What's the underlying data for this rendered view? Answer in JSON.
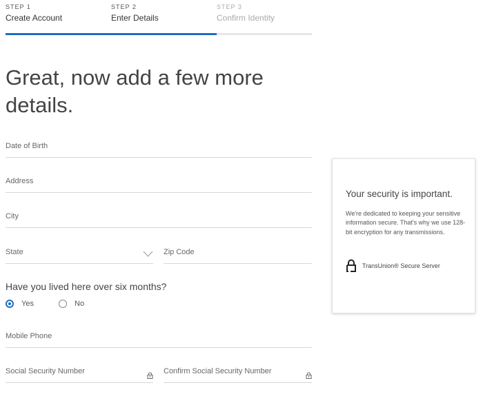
{
  "stepper": {
    "progress_percent": 69,
    "steps": [
      {
        "number": "STEP 1",
        "label": "Create Account",
        "state": "complete"
      },
      {
        "number": "STEP 2",
        "label": "Enter Details",
        "state": "current"
      },
      {
        "number": "STEP 3",
        "label": "Confirm Identity",
        "state": "upcoming"
      }
    ]
  },
  "page_title": "Great, now add a few more details.",
  "form": {
    "date_of_birth": {
      "label": "Date of Birth",
      "value": ""
    },
    "address": {
      "label": "Address",
      "value": ""
    },
    "city": {
      "label": "City",
      "value": ""
    },
    "state": {
      "label": "State",
      "value": ""
    },
    "zip": {
      "label": "Zip Code",
      "value": ""
    },
    "residency_question": "Have you lived here over six months?",
    "residency_options": [
      {
        "label": "Yes",
        "checked": true
      },
      {
        "label": "No",
        "checked": false
      }
    ],
    "mobile_phone": {
      "label": "Mobile Phone",
      "value": ""
    },
    "ssn": {
      "label": "Social Security Number",
      "value": ""
    },
    "ssn_confirm": {
      "label": "Confirm Social Security Number",
      "value": ""
    }
  },
  "security_card": {
    "title": "Your security is important.",
    "body": "We're dedicated to keeping your sensitive information secure. That's why we use 128-bit encryption for any transmissions.",
    "secure_label": "TransUnion® Secure Server",
    "icon": "lock-icon"
  },
  "colors": {
    "accent": "#1f6cc4",
    "track": "#e6e6e6"
  }
}
